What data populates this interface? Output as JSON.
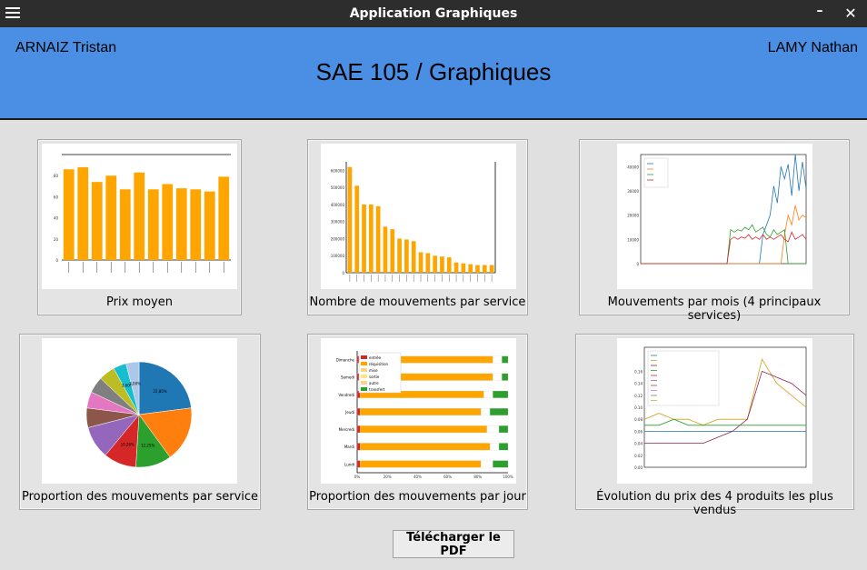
{
  "window": {
    "title": "Application Graphiques"
  },
  "header": {
    "left_name": "ARNAIZ Tristan",
    "right_name": "LAMY Nathan",
    "title": "SAE 105 / Graphiques"
  },
  "colors": {
    "accent": "#4a8fe3",
    "bar": "#ffa500",
    "titlebar": "#2d2d2d"
  },
  "cards": [
    {
      "label": "Prix moyen",
      "icon": "bar-chart-icon"
    },
    {
      "label": "Nombre de mouvements par service",
      "icon": "bar-chart-icon"
    },
    {
      "label": "Mouvements par mois (4 principaux services)",
      "icon": "line-chart-icon"
    },
    {
      "label": "Proportion des mouvements par service",
      "icon": "pie-chart-icon"
    },
    {
      "label": "Proportion des mouvements par jour",
      "icon": "stacked-bar-chart-icon"
    },
    {
      "label": "Évolution du prix des 4 produits les plus vendus",
      "icon": "line-chart-icon"
    }
  ],
  "actions": {
    "download_pdf": "Télécharger le PDF"
  },
  "chart_data": [
    {
      "type": "bar",
      "values": [
        86,
        88,
        74,
        80,
        67,
        83,
        67,
        72,
        68,
        67,
        65,
        79
      ],
      "ylim": [
        0,
        100
      ],
      "yticks": [
        0,
        20,
        40,
        60,
        80
      ]
    },
    {
      "type": "bar",
      "values": [
        620000,
        510000,
        400000,
        400000,
        390000,
        270000,
        255000,
        200000,
        195000,
        185000,
        120000,
        115000,
        100000,
        95000,
        90000,
        60000,
        55000,
        50000,
        45000,
        45000,
        45000
      ],
      "ylim": [
        0,
        650000
      ],
      "yticks": [
        "0",
        "100000",
        "200000",
        "300000",
        "400000",
        "500000",
        "600000"
      ]
    },
    {
      "type": "line",
      "ylim": [
        0,
        45000
      ],
      "yticks": [
        "0",
        "10000",
        "20000",
        "30000",
        "40000"
      ],
      "series": [
        {
          "color": "#1f77b4",
          "values": [
            0,
            0,
            0,
            0,
            0,
            0,
            0,
            0,
            0,
            0,
            0,
            0,
            0,
            0,
            0,
            0,
            0,
            0,
            0,
            0,
            0,
            0,
            0,
            0,
            0,
            0,
            0,
            0,
            0,
            0,
            0,
            0,
            0,
            0,
            12000,
            16000,
            20000,
            32000,
            25000,
            40000,
            35000,
            41000,
            28000,
            45000,
            30000,
            42000,
            31000
          ]
        },
        {
          "color": "#ff7f0e",
          "values": [
            0,
            0,
            0,
            0,
            0,
            0,
            0,
            0,
            0,
            0,
            0,
            0,
            0,
            0,
            0,
            0,
            0,
            0,
            0,
            0,
            0,
            0,
            0,
            0,
            0,
            0,
            0,
            0,
            0,
            0,
            0,
            0,
            0,
            0,
            0,
            0,
            0,
            0,
            0,
            0,
            12000,
            20000,
            16000,
            24000,
            18000,
            20000,
            19000
          ]
        },
        {
          "color": "#2ca02c",
          "values": [
            0,
            0,
            0,
            0,
            0,
            0,
            0,
            0,
            0,
            0,
            0,
            0,
            0,
            0,
            0,
            0,
            0,
            0,
            0,
            0,
            0,
            0,
            0,
            0,
            0,
            14000,
            13000,
            14000,
            13500,
            15000,
            14000,
            16000,
            13000,
            14000,
            15000,
            12000,
            11000,
            14000,
            12000,
            13000,
            14000,
            0,
            0,
            0,
            0,
            0,
            0
          ]
        },
        {
          "color": "#d62728",
          "values": [
            0,
            0,
            0,
            0,
            0,
            0,
            0,
            0,
            0,
            0,
            0,
            0,
            0,
            0,
            0,
            0,
            0,
            0,
            0,
            0,
            0,
            0,
            0,
            0,
            0,
            10000,
            11000,
            10000,
            11000,
            10500,
            12000,
            10000,
            11000,
            10000,
            12000,
            10000,
            11000,
            10000,
            11000,
            12000,
            10000,
            9000,
            13000,
            10000,
            11000,
            12000,
            10000
          ]
        }
      ]
    },
    {
      "type": "pie",
      "values": [
        23,
        17,
        11,
        10,
        10,
        6,
        5,
        5,
        5,
        4,
        4
      ],
      "colors": [
        "#1f77b4",
        "#ff7f0e",
        "#2ca02c",
        "#d62728",
        "#9467bd",
        "#8c564b",
        "#e377c2",
        "#7f7f7f",
        "#bcbd22",
        "#17becf",
        "#aec7e8"
      ],
      "percent_labels": [
        "22,85%",
        "",
        "12,25%",
        "10,26%",
        "",
        "",
        "",
        "",
        "",
        "3,60%",
        "3,00%"
      ]
    },
    {
      "type": "bar",
      "categories": [
        "Dimanche",
        "Samedi",
        "Vendredi",
        "Jeudi",
        "Mercredi",
        "Mardi",
        "Lundi"
      ],
      "xticks": [
        "0%",
        "20%",
        "40%",
        "60%",
        "80%",
        "100%"
      ],
      "legend": [
        "entrée",
        "réquisition",
        "mise",
        "sortie",
        "autre",
        "transfert"
      ],
      "series_colors": [
        "#d62728",
        "#ffa500",
        "#ffd480",
        "#ffffff",
        "#2ca02c"
      ],
      "rows": [
        [
          2,
          88,
          0,
          6,
          4
        ],
        [
          2,
          88,
          0,
          6,
          4
        ],
        [
          2,
          82,
          0,
          6,
          10
        ],
        [
          2,
          80,
          0,
          6,
          12
        ],
        [
          2,
          84,
          0,
          8,
          6
        ],
        [
          2,
          86,
          0,
          6,
          6
        ],
        [
          2,
          80,
          0,
          8,
          10
        ]
      ]
    },
    {
      "type": "line",
      "ylim": [
        0,
        0.2
      ],
      "yticks": [
        "0.00",
        "0.02",
        "0.04",
        "0.06",
        "0.08",
        "0.10",
        "0.12",
        "0.14",
        "0.16"
      ],
      "series": [
        {
          "color": "#1f77b4",
          "values": [
            0.06,
            0.06,
            0.06,
            0.06,
            0.06,
            0.06,
            0.06,
            0.06,
            0.06,
            0.06,
            0.06,
            0.06
          ]
        },
        {
          "color": "#d4a017",
          "values": [
            0.08,
            0.09,
            0.08,
            0.08,
            0.07,
            0.08,
            0.08,
            0.08,
            0.18,
            0.14,
            0.12,
            0.1
          ]
        },
        {
          "color": "#8b2252",
          "values": [
            0.04,
            0.04,
            0.04,
            0.04,
            0.04,
            0.05,
            0.06,
            0.08,
            0.16,
            0.15,
            0.14,
            0.12
          ]
        },
        {
          "color": "#2ca02c",
          "values": [
            0.07,
            0.07,
            0.08,
            0.07,
            0.07,
            0.07,
            0.07,
            0.07,
            0.07,
            0.07,
            0.07,
            0.07
          ]
        }
      ]
    }
  ]
}
